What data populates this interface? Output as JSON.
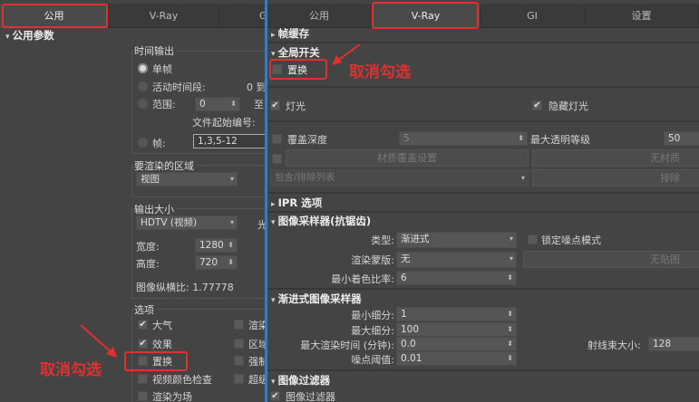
{
  "left": {
    "tabs": [
      "公用",
      "V-Ray",
      "GI"
    ],
    "section": "公用参数",
    "time_output": {
      "title": "时间输出",
      "single": "单帧",
      "active": "活动时间段:",
      "active_value": "0 到",
      "range": "范围:",
      "range_from": "0",
      "range_to_label": "至",
      "file_start": "文件起始编号:",
      "frames": "帧:",
      "frames_value": "1,3,5-12"
    },
    "area": {
      "title": "要渲染的区域",
      "value": "视图"
    },
    "output_size": {
      "title": "输出大小",
      "preset": "HDTV (视频)",
      "aperture_label": "光",
      "width_label": "宽度:",
      "width": "1280",
      "height_label": "高度:",
      "height": "720",
      "aspect": "图像纵横比: 1.77778"
    },
    "options": {
      "title": "选项",
      "items": [
        {
          "label": "大气",
          "checked": true
        },
        {
          "label": "效果",
          "checked": true
        },
        {
          "label": "置换",
          "checked": false
        },
        {
          "label": "视频颜色检查",
          "checked": false
        },
        {
          "label": "渲染为场",
          "checked": false
        }
      ],
      "items2": [
        "渲染",
        "区域",
        "强制",
        "超级"
      ]
    },
    "annotation": "取消勾选"
  },
  "right": {
    "tabs": [
      "公用",
      "V-Ray",
      "GI",
      "设置"
    ],
    "frame_buffer": "帧缓存",
    "global_switches": "全局开关",
    "displacement": "置换",
    "annotation": "取消勾选",
    "lights": "灯光",
    "hidden_lights": "隐藏灯光",
    "override_depth": "覆盖深度",
    "override_depth_value": "5",
    "max_transp": "最大透明等级",
    "max_transp_value": "50",
    "mtl_override": "材质覆盖设置",
    "no_material": "无材质",
    "include_exclude": "包含/排除列表",
    "exclude": "排除",
    "ipr": "IPR 选项",
    "image_sampler": {
      "title": "图像采样器(抗锯齿)",
      "type_label": "类型:",
      "type": "渐进式",
      "lock_noise": "锁定噪点模式",
      "mask_label": "渲染蒙版:",
      "mask": "无",
      "no_map": "无贴图",
      "min_shading_label": "最小着色比率:",
      "min_shading": "6"
    },
    "progressive": {
      "title": "渐进式图像采样器",
      "min_sub_label": "最小细分:",
      "min_sub": "1",
      "max_sub_label": "最大细分:",
      "max_sub": "100",
      "max_time_label": "最大渲染时间 (分钟):",
      "max_time": "0.0",
      "noise_label": "噪点阈值:",
      "noise": "0.01",
      "bundle_label": "射线束大小:",
      "bundle": "128"
    },
    "image_filter": {
      "title": "图像过滤器",
      "check": "图像过滤器"
    }
  }
}
